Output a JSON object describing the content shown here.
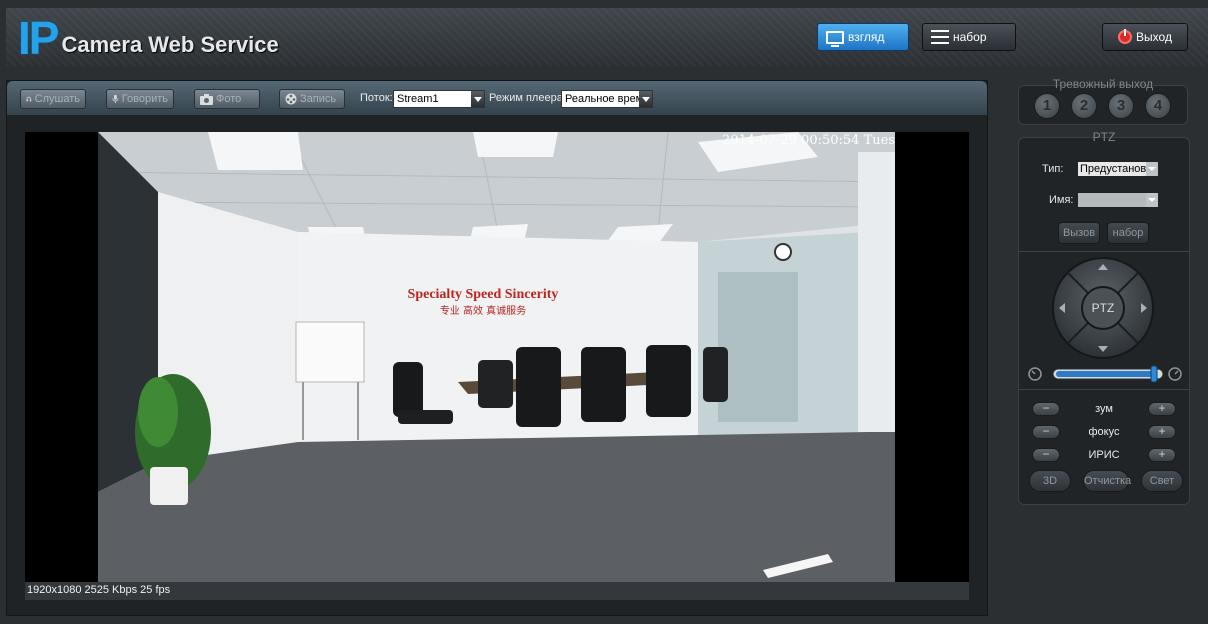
{
  "header": {
    "logo_ip": "IP",
    "logo_text": "Camera Web Service",
    "view_label": "взгляд",
    "settings_label": "набор",
    "exit_label": "Выход"
  },
  "toolbar": {
    "listen_label": "Слушать",
    "talk_label": "Говорить",
    "photo_label": "Фото",
    "record_label": "Запись",
    "stream_label": "Поток:",
    "stream_value": "Stream1",
    "player_mode_label": "Режим плеера:",
    "player_mode_value": "Реальное время"
  },
  "video": {
    "osd_timestamp": "2014-07-29 00:50:54 Tues",
    "wall_slogan_en": "Specialty Speed Sincerity",
    "wall_slogan_cn": "专业 高效 真诚服务",
    "stats": "1920x1080  2525 Kbps 25 fps"
  },
  "alarm_output": {
    "title": "Тревожный выход",
    "outputs": [
      "1",
      "2",
      "3",
      "4"
    ]
  },
  "ptz": {
    "title": "PTZ",
    "type_label": "Тип:",
    "type_value": "Предустановка",
    "name_label": "Имя:",
    "name_value": "",
    "call_label": "Вызов",
    "set_label": "набор",
    "center_label": "PTZ",
    "speed_level": 0.95,
    "zoom_label": "зум",
    "focus_label": "фокус",
    "iris_label": "ИРИС",
    "minus": "−",
    "plus": "+",
    "btn_3d": "3D",
    "btn_clean": "Отчистка",
    "btn_light": "Свет"
  },
  "colors": {
    "accent": "#25a3ea",
    "exit_red": "#d92a2a"
  }
}
